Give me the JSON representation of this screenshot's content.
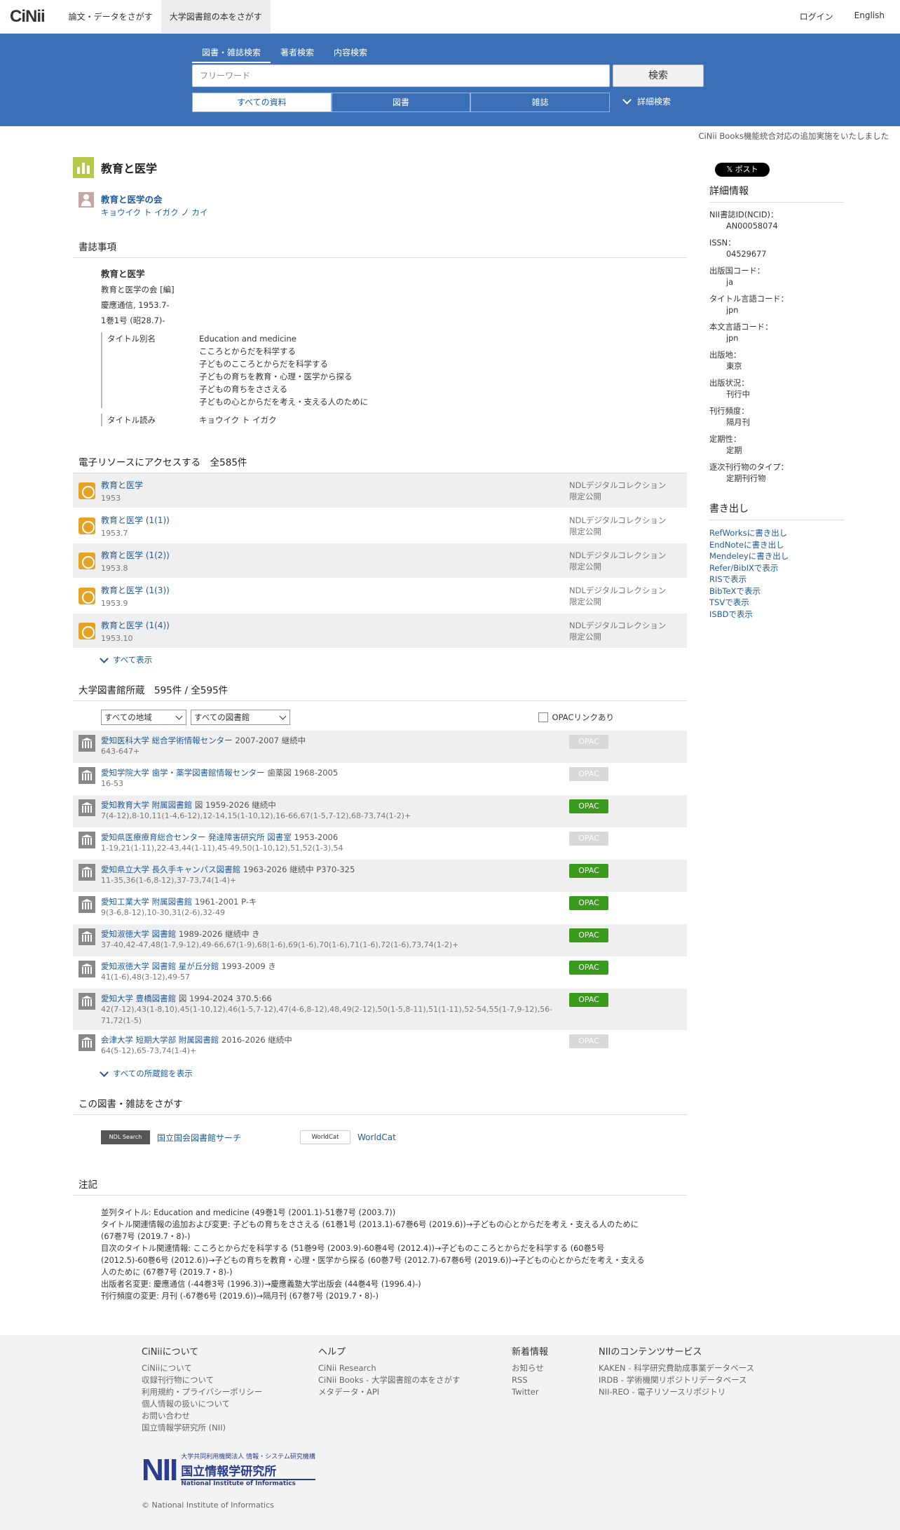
{
  "header": {
    "logo": "CiNii",
    "nav": [
      "論文・データをさがす",
      "大学図書館の本をさがす"
    ],
    "login": "ログイン",
    "english": "English"
  },
  "search": {
    "tabs": [
      "図書・雑誌検索",
      "著者検索",
      "内容検索"
    ],
    "placeholder": "フリーワード",
    "button": "検索",
    "material_tabs": [
      "すべての資料",
      "図書",
      "雑誌"
    ],
    "advanced": "詳細検索"
  },
  "notice": "CiNii Books機能統合対応の追加実施をいたしました",
  "title": "教育と医学",
  "author": {
    "name": "教育と医学の会",
    "kana": "キョウイク ト イガク ノ カイ"
  },
  "biblio": {
    "section": "書誌事項",
    "title": "教育と医学",
    "author": "教育と医学の会 [編]",
    "publisher": "慶應通信, 1953.7-",
    "volume": "1巻1号 (昭28.7)-",
    "alt_title_label": "タイトル別名",
    "alt_titles": [
      "Education and medicine",
      "こころとからだを科学する",
      "子どものこころとからだを科学する",
      "子どもの育ちを教育・心理・医学から探る",
      "子どもの育ちをささえる",
      "子どもの心とからだを考え・支える人のために"
    ],
    "reading_label": "タイトル読み",
    "reading": "キョウイク ト イガク"
  },
  "eresources": {
    "section": "電子リソースにアクセスする　全585件",
    "items": [
      {
        "title": "教育と医学",
        "date": "1953",
        "src1": "NDLデジタルコレクション",
        "src2": "限定公開"
      },
      {
        "title": "教育と医学 (1(1))",
        "date": "1953.7",
        "src1": "NDLデジタルコレクション",
        "src2": "限定公開"
      },
      {
        "title": "教育と医学 (1(2))",
        "date": "1953.8",
        "src1": "NDLデジタルコレクション",
        "src2": "限定公開"
      },
      {
        "title": "教育と医学 (1(3))",
        "date": "1953.9",
        "src1": "NDLデジタルコレクション",
        "src2": "限定公開"
      },
      {
        "title": "教育と医学 (1(4))",
        "date": "1953.10",
        "src1": "NDLデジタルコレクション",
        "src2": "限定公開"
      }
    ],
    "show_all": "すべて表示"
  },
  "holdings": {
    "section": "大学図書館所蔵　595件 / 全595件",
    "region": "すべての地域",
    "library": "すべての図書館",
    "opac_check": "OPACリンクあり",
    "items": [
      {
        "name": "愛知医科大学 総合学術情報センター",
        "meta": "2007-2007  継続中",
        "holdings": "643-647+",
        "opac": "OPAC",
        "on": false
      },
      {
        "name": "愛知学院大学 歯学・薬学図書館情報センター",
        "meta": "歯薬図  1968-2005",
        "holdings": "16-53",
        "opac": "OPAC",
        "on": false
      },
      {
        "name": "愛知教育大学 附属図書館",
        "meta": "図  1959-2026  継続中",
        "holdings": "7(4-12),8-10,11(1-4,6-12),12-14,15(1-10,12),16-66,67(1-5,7-12),68-73,74(1-2)+",
        "opac": "OPAC",
        "on": true
      },
      {
        "name": "愛知県医療療育総合センター 発達障害研究所 図書室",
        "meta": "1953-2006",
        "holdings": "1-19,21(1-11),22-43,44(1-11),45-49,50(1-10,12),51,52(1-3),54",
        "opac": "OPAC",
        "on": false
      },
      {
        "name": "愛知県立大学 長久手キャンパス図書館",
        "meta": "1963-2026  継続中  P370-325",
        "holdings": "11-35,36(1-6,8-12),37-73,74(1-4)+",
        "opac": "OPAC",
        "on": true
      },
      {
        "name": "愛知工業大学 附属図書館",
        "meta": "1961-2001  P-キ",
        "holdings": "9(3-6,8-12),10-30,31(2-6),32-49",
        "opac": "OPAC",
        "on": true
      },
      {
        "name": "愛知淑徳大学 図書館",
        "meta": "1989-2026  継続中  き",
        "holdings": "37-40,42-47,48(1-7,9-12),49-66,67(1-9),68(1-6),69(1-6),70(1-6),71(1-6),72(1-6),73,74(1-2)+",
        "opac": "OPAC",
        "on": true
      },
      {
        "name": "愛知淑徳大学 図書館 星が丘分館",
        "meta": "1993-2009  き",
        "holdings": "41(1-6),48(3-12),49-57",
        "opac": "OPAC",
        "on": true
      },
      {
        "name": "愛知大学 豊橋図書館",
        "meta": "図  1994-2024  370.5:66",
        "holdings": "42(7-12),43(1-8,10),45(1-10,12),46(1-5,7-12),47(4-6,8-12),48,49(2-12),50(1-5,8-11),51(1-11),52-54,55(1-7,9-12),56-71,72(1-5)",
        "opac": "OPAC",
        "on": true
      },
      {
        "name": "会津大学 短期大学部 附属図書館",
        "meta": "2016-2026  継続中",
        "holdings": "64(5-12),65-73,74(1-4)+",
        "opac": "OPAC",
        "on": false
      }
    ],
    "show_all": "すべての所蔵館を表示"
  },
  "findmore": {
    "section": "この図書・雑誌をさがす",
    "ndl_logo": "NDL Search",
    "ndl": "国立国会図書館サーチ",
    "wc_logo": "WorldCat",
    "wc": "WorldCat"
  },
  "notes": {
    "section": "注記",
    "lines": [
      "並列タイトル: Education and medicine (49巻1号 (2001.1)-51巻7号 (2003.7))",
      "タイトル関連情報の追加および変更: 子どもの育ちをささえる (61巻1号 (2013.1)-67巻6号 (2019.6))→子どもの心とからだを考え・支える人のために (67巻7号 (2019.7・8)-)",
      "目次のタイトル関連情報: こころとからだを科学する (51巻9号 (2003.9)-60巻4号 (2012.4))→子どものこころとからだを科学する (60巻5号 (2012.5)-60巻6号 (2012.6))→子どもの育ちを教育・心理・医学から探る (60巻7号 (2012.7)-67巻6号 (2019.6))→子どもの心とからだを考え・支える人のために (67巻7号 (2019.7・8)-)",
      "出版者名変更: 慶應通信 (-44巻3号 (1996.3))→慶應義塾大学出版会 (44巻4号 (1996.4)-)",
      "刊行頻度の変更: 月刊 (-67巻6号 (2019.6))→隔月刊 (67巻7号 (2019.7・8)-)"
    ]
  },
  "side": {
    "post": "𝕏 ポスト",
    "detail": "詳細情報",
    "fields": [
      [
        "NII書誌ID(NCID)：",
        "AN00058074"
      ],
      [
        "ISSN：",
        "04529677"
      ],
      [
        "出版国コード：",
        "ja"
      ],
      [
        "タイトル言語コード：",
        "jpn"
      ],
      [
        "本文言語コード：",
        "jpn"
      ],
      [
        "出版地：",
        "東京"
      ],
      [
        "出版状況：",
        "刊行中"
      ],
      [
        "刊行頻度：",
        "隔月刊"
      ],
      [
        "定期性：",
        "定期"
      ],
      [
        "逐次刊行物のタイプ：",
        "定期刊行物"
      ]
    ],
    "export": "書き出し",
    "exports": [
      "RefWorksに書き出し",
      "EndNoteに書き出し",
      "Mendeleyに書き出し",
      "Refer/BibIXで表示",
      "RISで表示",
      "BibTeXで表示",
      "TSVで表示",
      "ISBDで表示"
    ]
  },
  "footer": {
    "cols": [
      {
        "h": "CiNiiについて",
        "items": [
          "CiNiiについて",
          "収録刊行物について",
          "利用規約・プライバシーポリシー",
          "個人情報の扱いについて",
          "お問い合わせ",
          "国立情報学研究所 (NII)"
        ]
      },
      {
        "h": "ヘルプ",
        "items": [
          "CiNii Research",
          "CiNii Books - 大学図書館の本をさがす",
          "メタデータ・API"
        ]
      },
      {
        "h": "新着情報",
        "items": [
          "お知らせ",
          "RSS",
          "Twitter"
        ]
      },
      {
        "h": "NIIのコンテンツサービス",
        "items": [
          "KAKEN - 科学研究費助成事業データベース",
          "IRDB - 学術機関リポジトリデータベース",
          "NII-REO - 電子リソースリポジトリ"
        ]
      }
    ],
    "nii_big": "NII",
    "nii_small": "大学共同利用機関法人 情報・システム研究機構",
    "nii_jp": "国立情報学研究所",
    "nii_en": "National Institute of Informatics",
    "copyright": "© National Institute of Informatics"
  }
}
